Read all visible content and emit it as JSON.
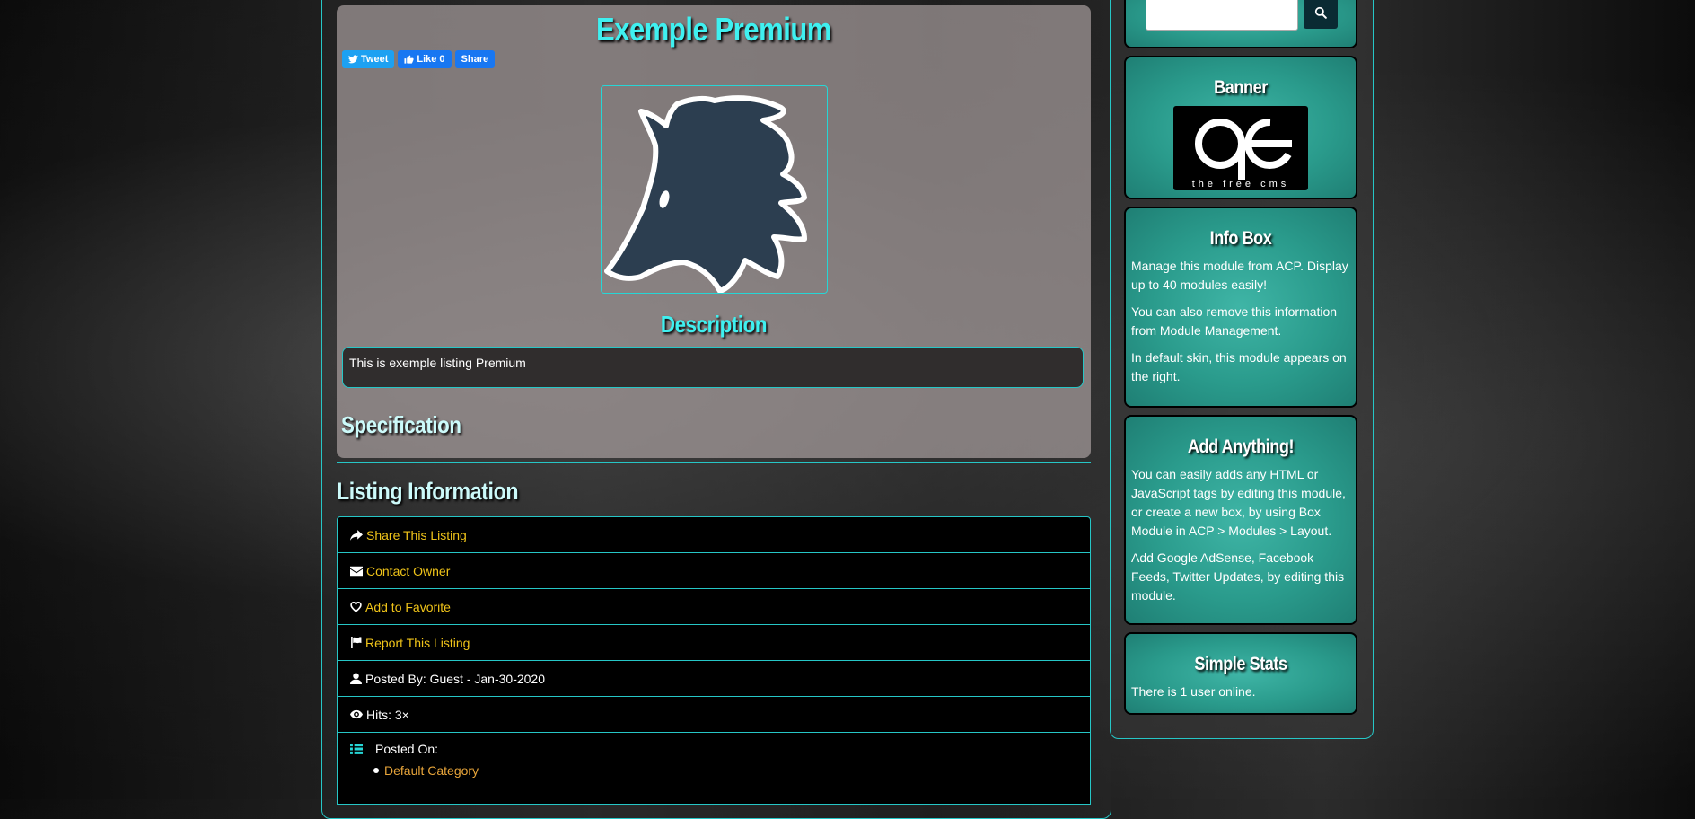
{
  "listing": {
    "title": "Exemple Premium",
    "social": {
      "tweet": "Tweet",
      "like": "Like 0",
      "share": "Share"
    },
    "description_heading": "Description",
    "description": "This is exemple listing Premium",
    "specification_heading": "Specification"
  },
  "info": {
    "heading": "Listing Information",
    "share": "Share This Listing",
    "contact": "Contact Owner",
    "favorite": "Add to Favorite",
    "report": "Report This Listing",
    "posted_by": "Posted By: Guest - Jan-30-2020",
    "hits": "Hits: 3×",
    "posted_on": "Posted On:",
    "category": "Default Category"
  },
  "sidebar": {
    "search_placeholder": "",
    "banner": {
      "title": "Banner",
      "logo_text": "the free cms"
    },
    "info_box": {
      "title": "Info Box",
      "p1": "Manage this module from ACP. Display up to 40 modules easily!",
      "p2": "You can also remove this information from Module Management.",
      "p3": "In default skin, this module appears on the right."
    },
    "add_anything": {
      "title": "Add Anything!",
      "p1": "You can easily adds any HTML or JavaScript tags by editing this module, or create a new box, by using Box Module in ACP > Modules > Layout.",
      "p2": "Add Google AdSense, Facebook Feeds, Twitter Updates, by editing this module."
    },
    "simple_stats": {
      "title": "Simple Stats",
      "text": "There is 1 user online."
    }
  },
  "colors": {
    "accent": "#26c6c6",
    "link": "#f0c419",
    "title": "#3ff0f0",
    "category": "#e8a53a"
  },
  "icons": [
    "share-icon",
    "envelope-icon",
    "heart-icon",
    "flag-icon",
    "user-icon",
    "eye-icon",
    "list-icon",
    "search-icon",
    "twitter-icon",
    "thumbs-up-icon"
  ]
}
